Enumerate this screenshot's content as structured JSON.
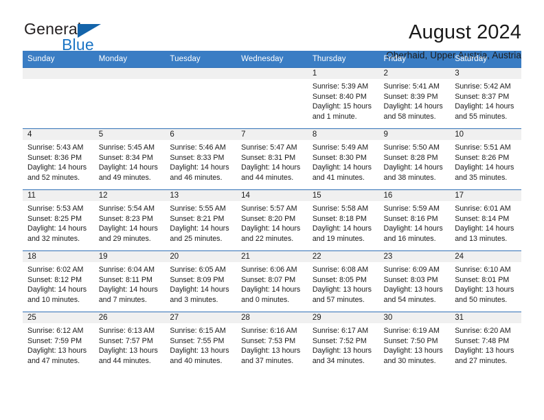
{
  "brand": {
    "name_part1": "General",
    "name_part2": "Blue",
    "triangle_icon": "logo-triangle",
    "color_dark": "#231f20",
    "color_blue": "#1a74c4"
  },
  "header": {
    "title": "August 2024",
    "subtitle": "Oberhaid, Upper Austria, Austria"
  },
  "calendar": {
    "header_bg": "#3a7dc4",
    "weekday_headers": [
      "Sunday",
      "Monday",
      "Tuesday",
      "Wednesday",
      "Thursday",
      "Friday",
      "Saturday"
    ],
    "weeks": [
      [
        {
          "day": "",
          "empty": true,
          "sunrise": "",
          "sunset": "",
          "daylight_line1": "",
          "daylight_line2": ""
        },
        {
          "day": "",
          "empty": true,
          "sunrise": "",
          "sunset": "",
          "daylight_line1": "",
          "daylight_line2": ""
        },
        {
          "day": "",
          "empty": true,
          "sunrise": "",
          "sunset": "",
          "daylight_line1": "",
          "daylight_line2": ""
        },
        {
          "day": "",
          "empty": true,
          "sunrise": "",
          "sunset": "",
          "daylight_line1": "",
          "daylight_line2": ""
        },
        {
          "day": "1",
          "empty": false,
          "sunrise": "Sunrise: 5:39 AM",
          "sunset": "Sunset: 8:40 PM",
          "daylight_line1": "Daylight: 15 hours",
          "daylight_line2": "and 1 minute."
        },
        {
          "day": "2",
          "empty": false,
          "sunrise": "Sunrise: 5:41 AM",
          "sunset": "Sunset: 8:39 PM",
          "daylight_line1": "Daylight: 14 hours",
          "daylight_line2": "and 58 minutes."
        },
        {
          "day": "3",
          "empty": false,
          "sunrise": "Sunrise: 5:42 AM",
          "sunset": "Sunset: 8:37 PM",
          "daylight_line1": "Daylight: 14 hours",
          "daylight_line2": "and 55 minutes."
        }
      ],
      [
        {
          "day": "4",
          "empty": false,
          "sunrise": "Sunrise: 5:43 AM",
          "sunset": "Sunset: 8:36 PM",
          "daylight_line1": "Daylight: 14 hours",
          "daylight_line2": "and 52 minutes."
        },
        {
          "day": "5",
          "empty": false,
          "sunrise": "Sunrise: 5:45 AM",
          "sunset": "Sunset: 8:34 PM",
          "daylight_line1": "Daylight: 14 hours",
          "daylight_line2": "and 49 minutes."
        },
        {
          "day": "6",
          "empty": false,
          "sunrise": "Sunrise: 5:46 AM",
          "sunset": "Sunset: 8:33 PM",
          "daylight_line1": "Daylight: 14 hours",
          "daylight_line2": "and 46 minutes."
        },
        {
          "day": "7",
          "empty": false,
          "sunrise": "Sunrise: 5:47 AM",
          "sunset": "Sunset: 8:31 PM",
          "daylight_line1": "Daylight: 14 hours",
          "daylight_line2": "and 44 minutes."
        },
        {
          "day": "8",
          "empty": false,
          "sunrise": "Sunrise: 5:49 AM",
          "sunset": "Sunset: 8:30 PM",
          "daylight_line1": "Daylight: 14 hours",
          "daylight_line2": "and 41 minutes."
        },
        {
          "day": "9",
          "empty": false,
          "sunrise": "Sunrise: 5:50 AM",
          "sunset": "Sunset: 8:28 PM",
          "daylight_line1": "Daylight: 14 hours",
          "daylight_line2": "and 38 minutes."
        },
        {
          "day": "10",
          "empty": false,
          "sunrise": "Sunrise: 5:51 AM",
          "sunset": "Sunset: 8:26 PM",
          "daylight_line1": "Daylight: 14 hours",
          "daylight_line2": "and 35 minutes."
        }
      ],
      [
        {
          "day": "11",
          "empty": false,
          "sunrise": "Sunrise: 5:53 AM",
          "sunset": "Sunset: 8:25 PM",
          "daylight_line1": "Daylight: 14 hours",
          "daylight_line2": "and 32 minutes."
        },
        {
          "day": "12",
          "empty": false,
          "sunrise": "Sunrise: 5:54 AM",
          "sunset": "Sunset: 8:23 PM",
          "daylight_line1": "Daylight: 14 hours",
          "daylight_line2": "and 29 minutes."
        },
        {
          "day": "13",
          "empty": false,
          "sunrise": "Sunrise: 5:55 AM",
          "sunset": "Sunset: 8:21 PM",
          "daylight_line1": "Daylight: 14 hours",
          "daylight_line2": "and 25 minutes."
        },
        {
          "day": "14",
          "empty": false,
          "sunrise": "Sunrise: 5:57 AM",
          "sunset": "Sunset: 8:20 PM",
          "daylight_line1": "Daylight: 14 hours",
          "daylight_line2": "and 22 minutes."
        },
        {
          "day": "15",
          "empty": false,
          "sunrise": "Sunrise: 5:58 AM",
          "sunset": "Sunset: 8:18 PM",
          "daylight_line1": "Daylight: 14 hours",
          "daylight_line2": "and 19 minutes."
        },
        {
          "day": "16",
          "empty": false,
          "sunrise": "Sunrise: 5:59 AM",
          "sunset": "Sunset: 8:16 PM",
          "daylight_line1": "Daylight: 14 hours",
          "daylight_line2": "and 16 minutes."
        },
        {
          "day": "17",
          "empty": false,
          "sunrise": "Sunrise: 6:01 AM",
          "sunset": "Sunset: 8:14 PM",
          "daylight_line1": "Daylight: 14 hours",
          "daylight_line2": "and 13 minutes."
        }
      ],
      [
        {
          "day": "18",
          "empty": false,
          "sunrise": "Sunrise: 6:02 AM",
          "sunset": "Sunset: 8:12 PM",
          "daylight_line1": "Daylight: 14 hours",
          "daylight_line2": "and 10 minutes."
        },
        {
          "day": "19",
          "empty": false,
          "sunrise": "Sunrise: 6:04 AM",
          "sunset": "Sunset: 8:11 PM",
          "daylight_line1": "Daylight: 14 hours",
          "daylight_line2": "and 7 minutes."
        },
        {
          "day": "20",
          "empty": false,
          "sunrise": "Sunrise: 6:05 AM",
          "sunset": "Sunset: 8:09 PM",
          "daylight_line1": "Daylight: 14 hours",
          "daylight_line2": "and 3 minutes."
        },
        {
          "day": "21",
          "empty": false,
          "sunrise": "Sunrise: 6:06 AM",
          "sunset": "Sunset: 8:07 PM",
          "daylight_line1": "Daylight: 14 hours",
          "daylight_line2": "and 0 minutes."
        },
        {
          "day": "22",
          "empty": false,
          "sunrise": "Sunrise: 6:08 AM",
          "sunset": "Sunset: 8:05 PM",
          "daylight_line1": "Daylight: 13 hours",
          "daylight_line2": "and 57 minutes."
        },
        {
          "day": "23",
          "empty": false,
          "sunrise": "Sunrise: 6:09 AM",
          "sunset": "Sunset: 8:03 PM",
          "daylight_line1": "Daylight: 13 hours",
          "daylight_line2": "and 54 minutes."
        },
        {
          "day": "24",
          "empty": false,
          "sunrise": "Sunrise: 6:10 AM",
          "sunset": "Sunset: 8:01 PM",
          "daylight_line1": "Daylight: 13 hours",
          "daylight_line2": "and 50 minutes."
        }
      ],
      [
        {
          "day": "25",
          "empty": false,
          "sunrise": "Sunrise: 6:12 AM",
          "sunset": "Sunset: 7:59 PM",
          "daylight_line1": "Daylight: 13 hours",
          "daylight_line2": "and 47 minutes."
        },
        {
          "day": "26",
          "empty": false,
          "sunrise": "Sunrise: 6:13 AM",
          "sunset": "Sunset: 7:57 PM",
          "daylight_line1": "Daylight: 13 hours",
          "daylight_line2": "and 44 minutes."
        },
        {
          "day": "27",
          "empty": false,
          "sunrise": "Sunrise: 6:15 AM",
          "sunset": "Sunset: 7:55 PM",
          "daylight_line1": "Daylight: 13 hours",
          "daylight_line2": "and 40 minutes."
        },
        {
          "day": "28",
          "empty": false,
          "sunrise": "Sunrise: 6:16 AM",
          "sunset": "Sunset: 7:53 PM",
          "daylight_line1": "Daylight: 13 hours",
          "daylight_line2": "and 37 minutes."
        },
        {
          "day": "29",
          "empty": false,
          "sunrise": "Sunrise: 6:17 AM",
          "sunset": "Sunset: 7:52 PM",
          "daylight_line1": "Daylight: 13 hours",
          "daylight_line2": "and 34 minutes."
        },
        {
          "day": "30",
          "empty": false,
          "sunrise": "Sunrise: 6:19 AM",
          "sunset": "Sunset: 7:50 PM",
          "daylight_line1": "Daylight: 13 hours",
          "daylight_line2": "and 30 minutes."
        },
        {
          "day": "31",
          "empty": false,
          "sunrise": "Sunrise: 6:20 AM",
          "sunset": "Sunset: 7:48 PM",
          "daylight_line1": "Daylight: 13 hours",
          "daylight_line2": "and 27 minutes."
        }
      ]
    ]
  }
}
